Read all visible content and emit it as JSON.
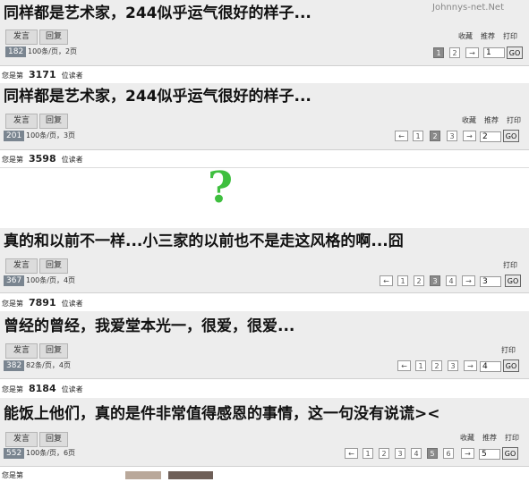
{
  "watermark": "Johnnys-net.Net",
  "question_mark": "?",
  "posts": [
    {
      "title": "同样都是艺术家，244似乎运气很好的样子...",
      "post_label": "发言",
      "reply_label": "回复",
      "count": "182",
      "per_page": "100条/页，2页",
      "links": [
        "收藏",
        "推荐",
        "打印"
      ],
      "pages": [
        "1",
        "2"
      ],
      "current_page": "1",
      "input_value": "1",
      "go_label": "GO",
      "reader_prefix": "您是第",
      "reader_num": "3171",
      "reader_suffix": "位读者"
    },
    {
      "title": "同样都是艺术家，244似乎运气很好的样子...",
      "post_label": "发言",
      "reply_label": "回复",
      "count": "201",
      "per_page": "100条/页，3页",
      "links": [
        "收藏",
        "推荐",
        "打印"
      ],
      "pages": [
        "1",
        "2",
        "3"
      ],
      "current_page": "2",
      "input_value": "2",
      "go_label": "GO",
      "reader_prefix": "您是第",
      "reader_num": "3598",
      "reader_suffix": "位读者"
    },
    {
      "title": "真的和以前不一样...小三家的以前也不是走这风格的啊...囧",
      "post_label": "发言",
      "reply_label": "回复",
      "count": "367",
      "per_page": "100条/页，4页",
      "links": [
        "打印"
      ],
      "pages": [
        "1",
        "2",
        "3",
        "4"
      ],
      "current_page": "3",
      "input_value": "3",
      "go_label": "GO",
      "reader_prefix": "您是第",
      "reader_num": "7891",
      "reader_suffix": "位读者"
    },
    {
      "title": "曾经的曾经，我爱堂本光一，很爱，很爱...",
      "post_label": "发言",
      "reply_label": "回复",
      "count": "382",
      "per_page": "82条/页，4页",
      "links": [
        "打印"
      ],
      "pages": [
        "1",
        "2",
        "3",
        "4"
      ],
      "current_page": "4",
      "input_value": "4",
      "go_label": "GO",
      "reader_prefix": "您是第",
      "reader_num": "8184",
      "reader_suffix": "位读者"
    },
    {
      "title": "能饭上他们，真的是件非常值得感恩的事情，这一句没有说谎><",
      "post_label": "发言",
      "reply_label": "回复",
      "count": "552",
      "per_page": "100条/页，6页",
      "links": [
        "收藏",
        "推荐",
        "打印"
      ],
      "pages": [
        "1",
        "2",
        "3",
        "4",
        "5",
        "6"
      ],
      "current_page": "5",
      "input_value": "5",
      "go_label": "GO",
      "reader_prefix": "您是第",
      "reader_num": "",
      "reader_suffix": ""
    }
  ]
}
